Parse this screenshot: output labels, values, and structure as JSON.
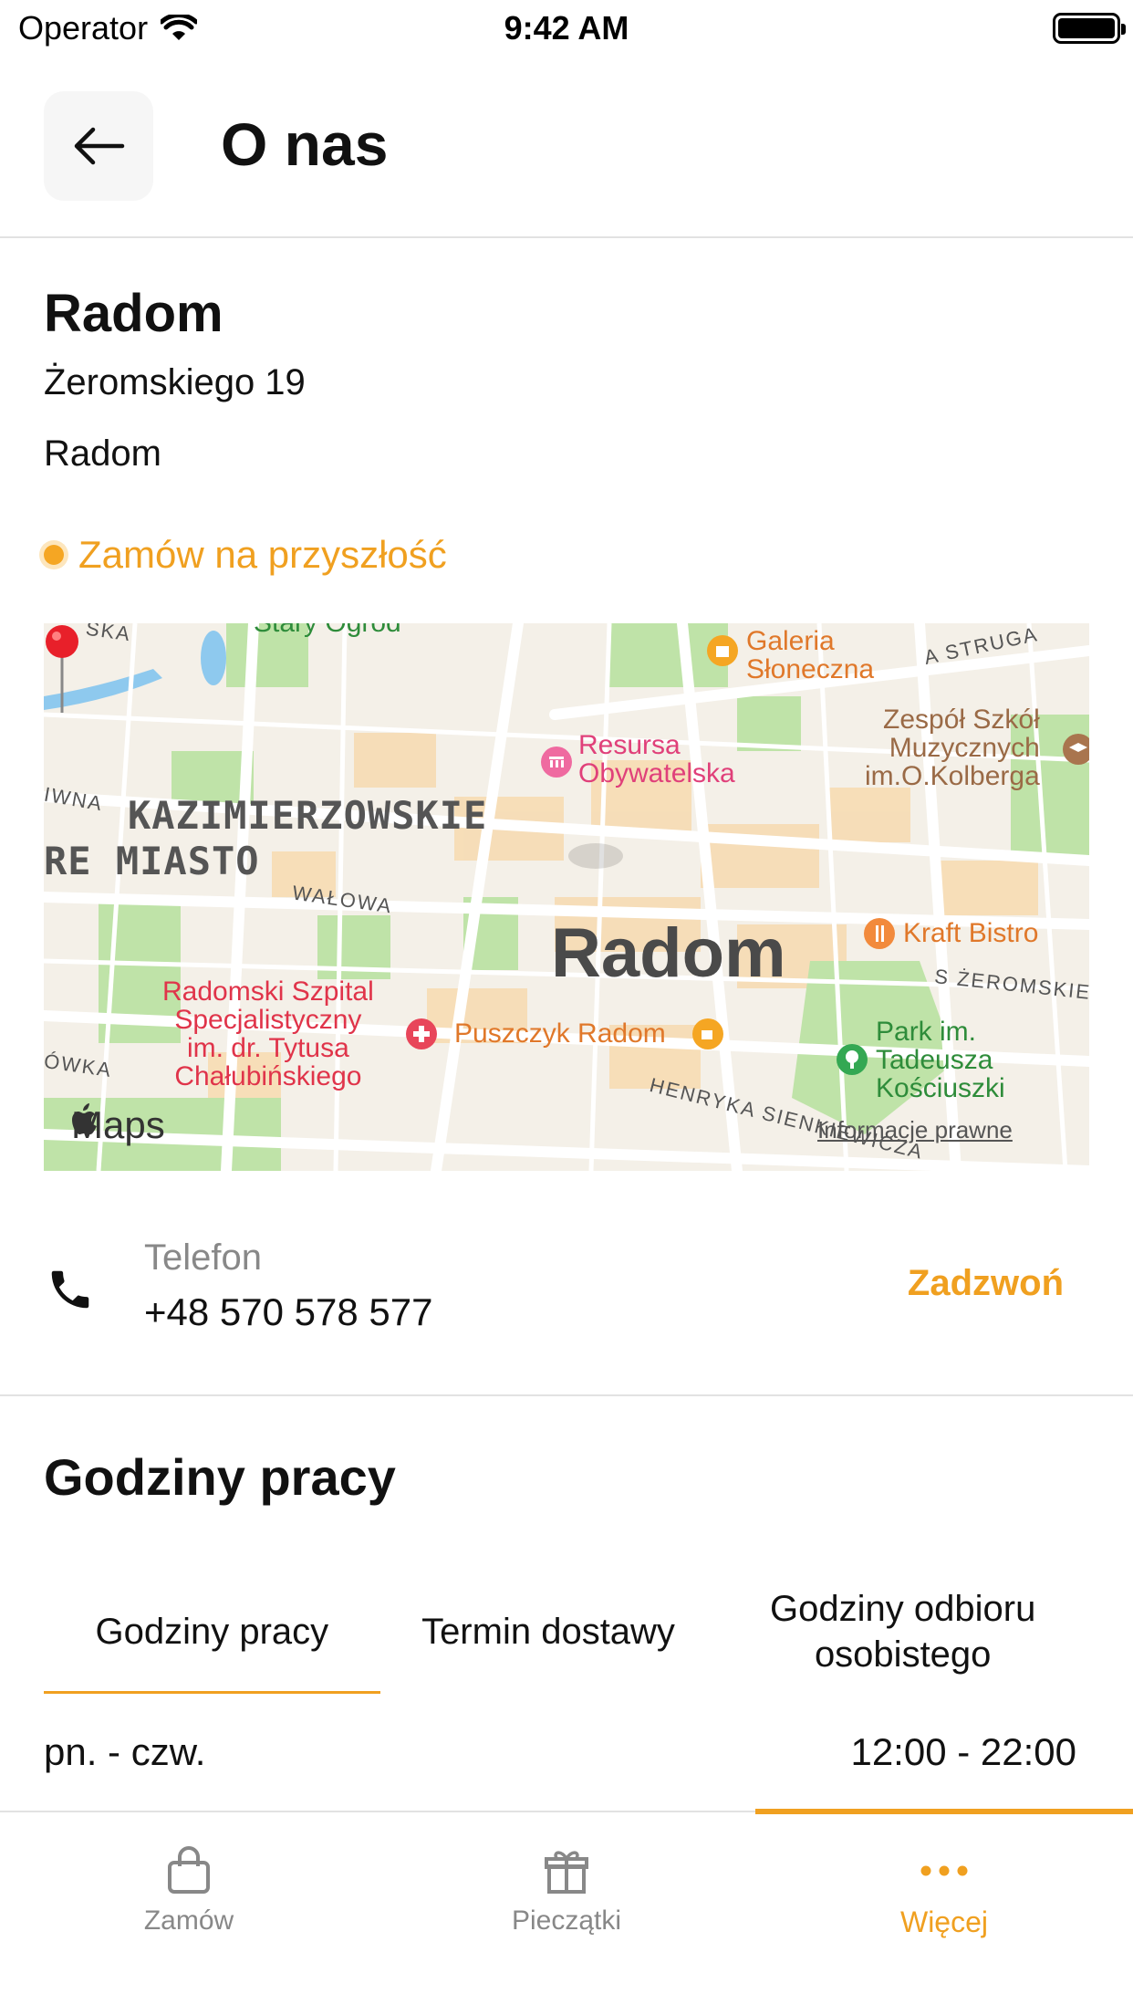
{
  "status_bar": {
    "carrier": "Operator",
    "time": "9:42 AM"
  },
  "header": {
    "title": "O nas"
  },
  "location": {
    "name": "Radom",
    "address_line1": "Żeromskiego 19",
    "address_line2": "Radom",
    "status": "Zamów na przyszłość"
  },
  "map": {
    "city_label": "Radom",
    "district_line1": "KAZIMIERZOWSKIE",
    "district_line2": "RE MIASTO",
    "poi": {
      "stary_ogrod": "Stary Ogród",
      "galeria_1": "Galeria",
      "galeria_2": "Słoneczna",
      "resursa_1": "Resursa",
      "resursa_2": "Obywatelska",
      "zespol_1": "Zespół Szkół",
      "zespol_2": "Muzycznych",
      "zespol_3": "im.O.Kolberga",
      "kraft": "Kraft Bistro",
      "szpital_1": "Radomski Szpital",
      "szpital_2": "Specjalistyczny",
      "szpital_3": "im. dr. Tytusa",
      "szpital_4": "Chałubińskiego",
      "puszczyk": "Puszczyk Radom",
      "park_1": "Park im.",
      "park_2": "Tadeusza",
      "park_3": "Kościuszki"
    },
    "streets": {
      "walowa": "WAŁOWA",
      "zeromskiego": "S ŻEROMSKIEG",
      "sienkiewicza": "HENRYKA SIENKIEWICZA",
      "struga": "A STRUGA",
      "left_top": "IWNA",
      "left_bottom": "ÓWKA",
      "top_left": "SKA"
    },
    "attribution": "Maps",
    "legal": "Informacje prawne"
  },
  "phone": {
    "label": "Telefon",
    "number": "+48 570 578 577",
    "call_label": "Zadzwoń"
  },
  "hours": {
    "title": "Godziny pracy",
    "tabs": [
      {
        "label": "Godziny pracy",
        "active": true
      },
      {
        "label": "Termin dostawy",
        "active": false
      },
      {
        "label": "Godziny odbioru osobistego",
        "active": false
      }
    ],
    "rows": [
      {
        "days": "pn. - czw.",
        "time": "12:00 - 22:00"
      }
    ]
  },
  "bottom_nav": {
    "items": [
      {
        "label": "Zamów",
        "icon": "bag-icon",
        "active": false
      },
      {
        "label": "Pieczątki",
        "icon": "gift-icon",
        "active": false
      },
      {
        "label": "Więcej",
        "icon": "more-dots-icon",
        "active": true
      }
    ]
  },
  "colors": {
    "accent": "#f0a020",
    "divider": "#e2e2e2",
    "muted": "#888888"
  }
}
